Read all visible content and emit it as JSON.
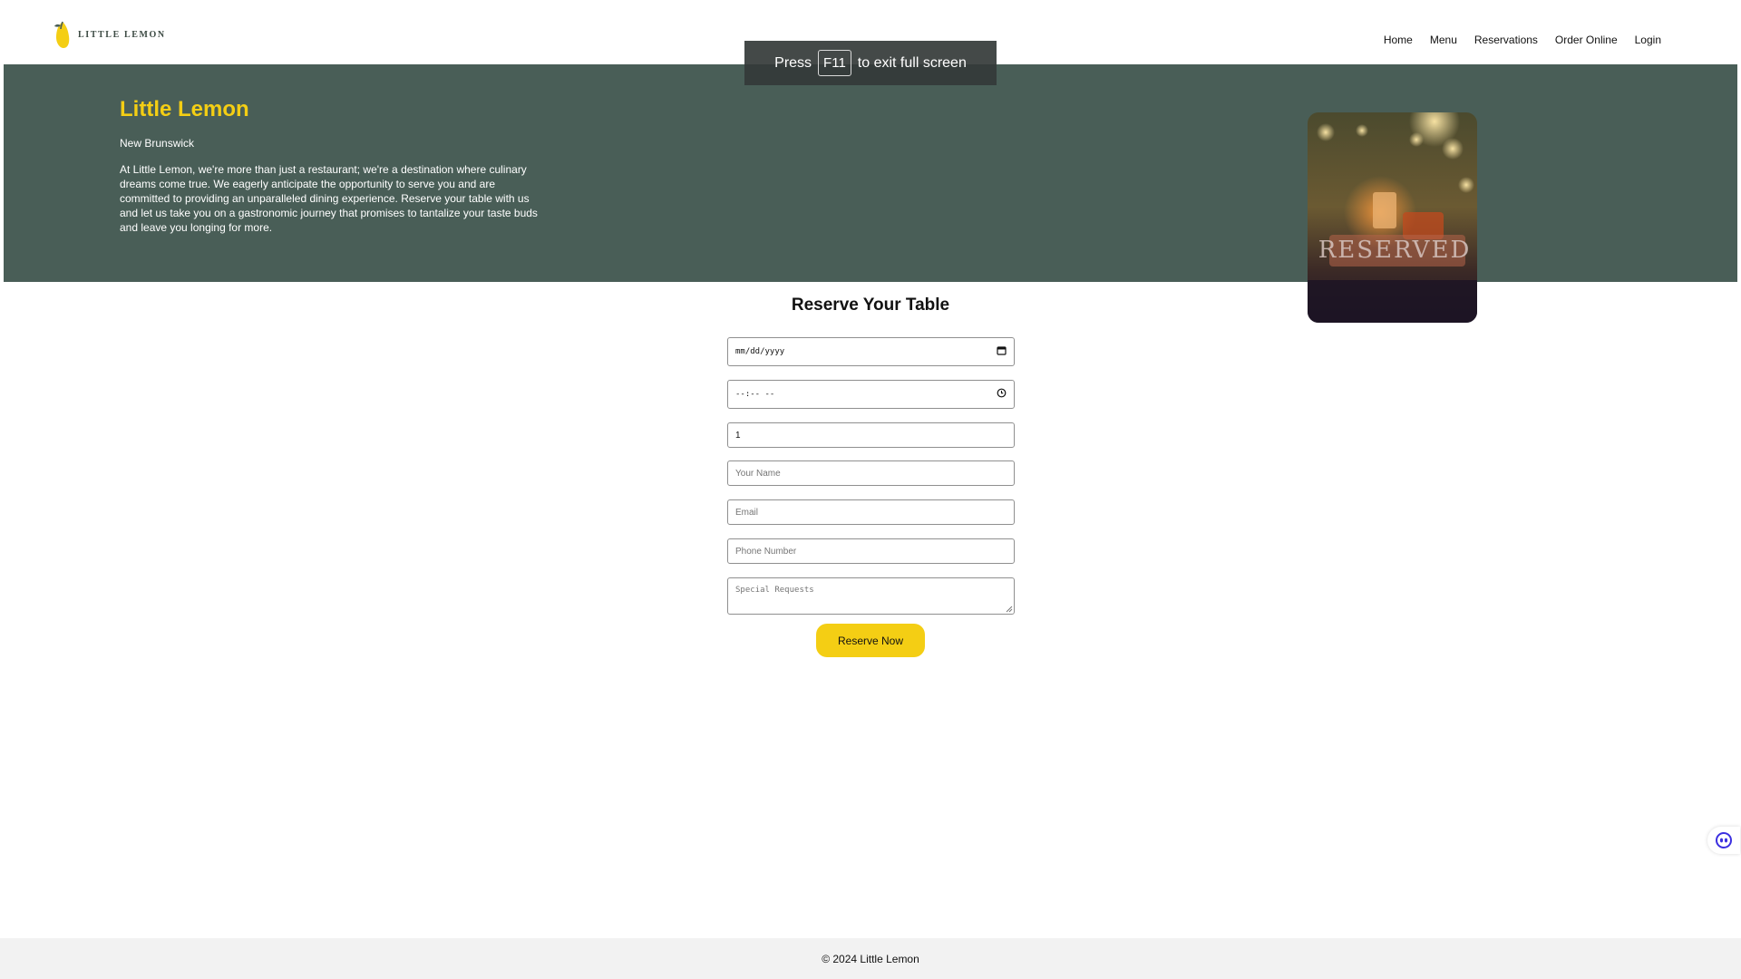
{
  "brand": {
    "name": "LITTLE LEMON"
  },
  "nav": {
    "items": [
      {
        "label": "Home"
      },
      {
        "label": "Menu"
      },
      {
        "label": "Reservations"
      },
      {
        "label": "Order Online"
      },
      {
        "label": "Login"
      }
    ]
  },
  "fullscreen_notice": {
    "prefix": "Press",
    "key": "F11",
    "suffix": "to exit full screen"
  },
  "hero": {
    "title": "Little Lemon",
    "city": "New Brunswick",
    "description": "At Little Lemon, we're more than just a restaurant; we're a destination where culinary dreams come true. We eagerly anticipate the opportunity to serve you and are committed to providing an unparalleled dining experience. Reserve your table with us and let us take you on a gastronomic journey that promises to tantalize your taste buds and leave you longing for more.",
    "photo_text": "RESERVED"
  },
  "form": {
    "title": "Reserve Your Table",
    "date_placeholder": "mm/dd/yyyy",
    "time_placeholder": "--:-- --",
    "guests_value": "1",
    "name_placeholder": "Your Name",
    "email_placeholder": "Email",
    "phone_placeholder": "Phone Number",
    "requests_placeholder": "Special Requests",
    "submit_label": "Reserve Now"
  },
  "footer": {
    "text": "© 2024 Little Lemon"
  },
  "colors": {
    "hero_bg": "#495e57",
    "brand_yellow": "#f4ce14",
    "footer_bg": "#f2f2f2"
  },
  "icons": {
    "logo": "lemon-icon",
    "date": "calendar-icon",
    "time": "clock-icon",
    "float": "assistant-eyes-icon"
  }
}
